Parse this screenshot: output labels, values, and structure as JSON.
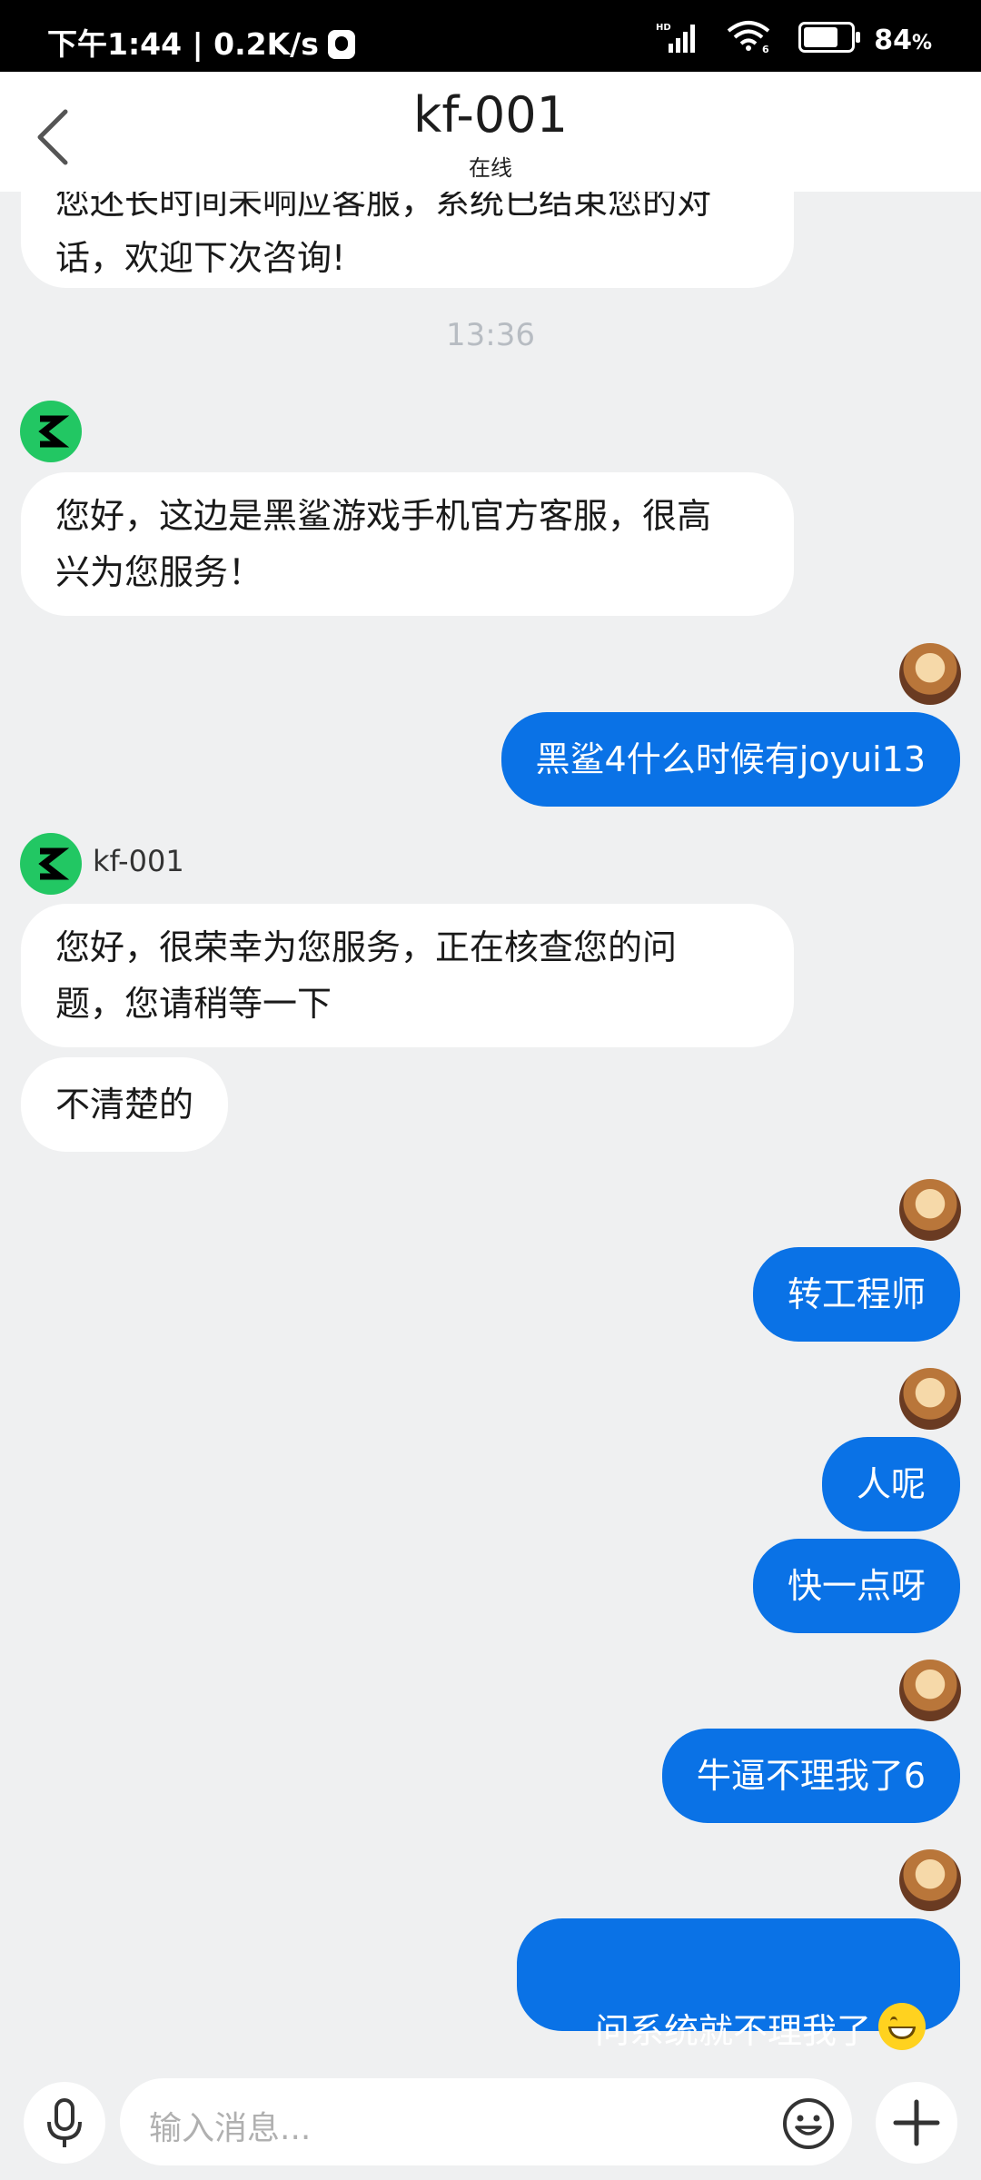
{
  "status_bar": {
    "time_speed": "下午1:44 | 0.2K/s",
    "battery_pct": "84",
    "battery_suffix": "%",
    "network_tag": "HD",
    "wifi_tag": "6",
    "battery_level": 0.84
  },
  "header": {
    "title": "kf-001",
    "subtitle": "在线"
  },
  "messages": [
    {
      "side": "in",
      "text": "您还长时间未响应客服，系统已结束您的对\n话，欢迎下次咨询!"
    },
    {
      "type": "time",
      "text": "13:36"
    },
    {
      "side": "in",
      "text": "您好，这边是黑鲨游戏手机官方客服，很高\n兴为您服务！"
    },
    {
      "side": "out",
      "text": "黑鲨4什么时候有joyui13"
    },
    {
      "side": "in",
      "sender": "kf-001",
      "text": "您好，很荣幸为您服务，正在核查您的问\n题，您请稍等一下"
    },
    {
      "side": "in",
      "text": "不清楚的"
    },
    {
      "side": "out",
      "text": "转工程师"
    },
    {
      "side": "out",
      "text": "人呢"
    },
    {
      "side": "out",
      "text": "快一点呀"
    },
    {
      "side": "out",
      "text": "牛逼不理我了6"
    },
    {
      "side": "out",
      "text": "问系统就不理我了",
      "emoji": "grinning-face"
    }
  ],
  "input": {
    "placeholder": "输入消息..."
  },
  "colors": {
    "out_bubble": "#0a72e6",
    "in_bubble": "#ffffff",
    "background": "#eff0f1",
    "agent_avatar": "#22c763"
  }
}
